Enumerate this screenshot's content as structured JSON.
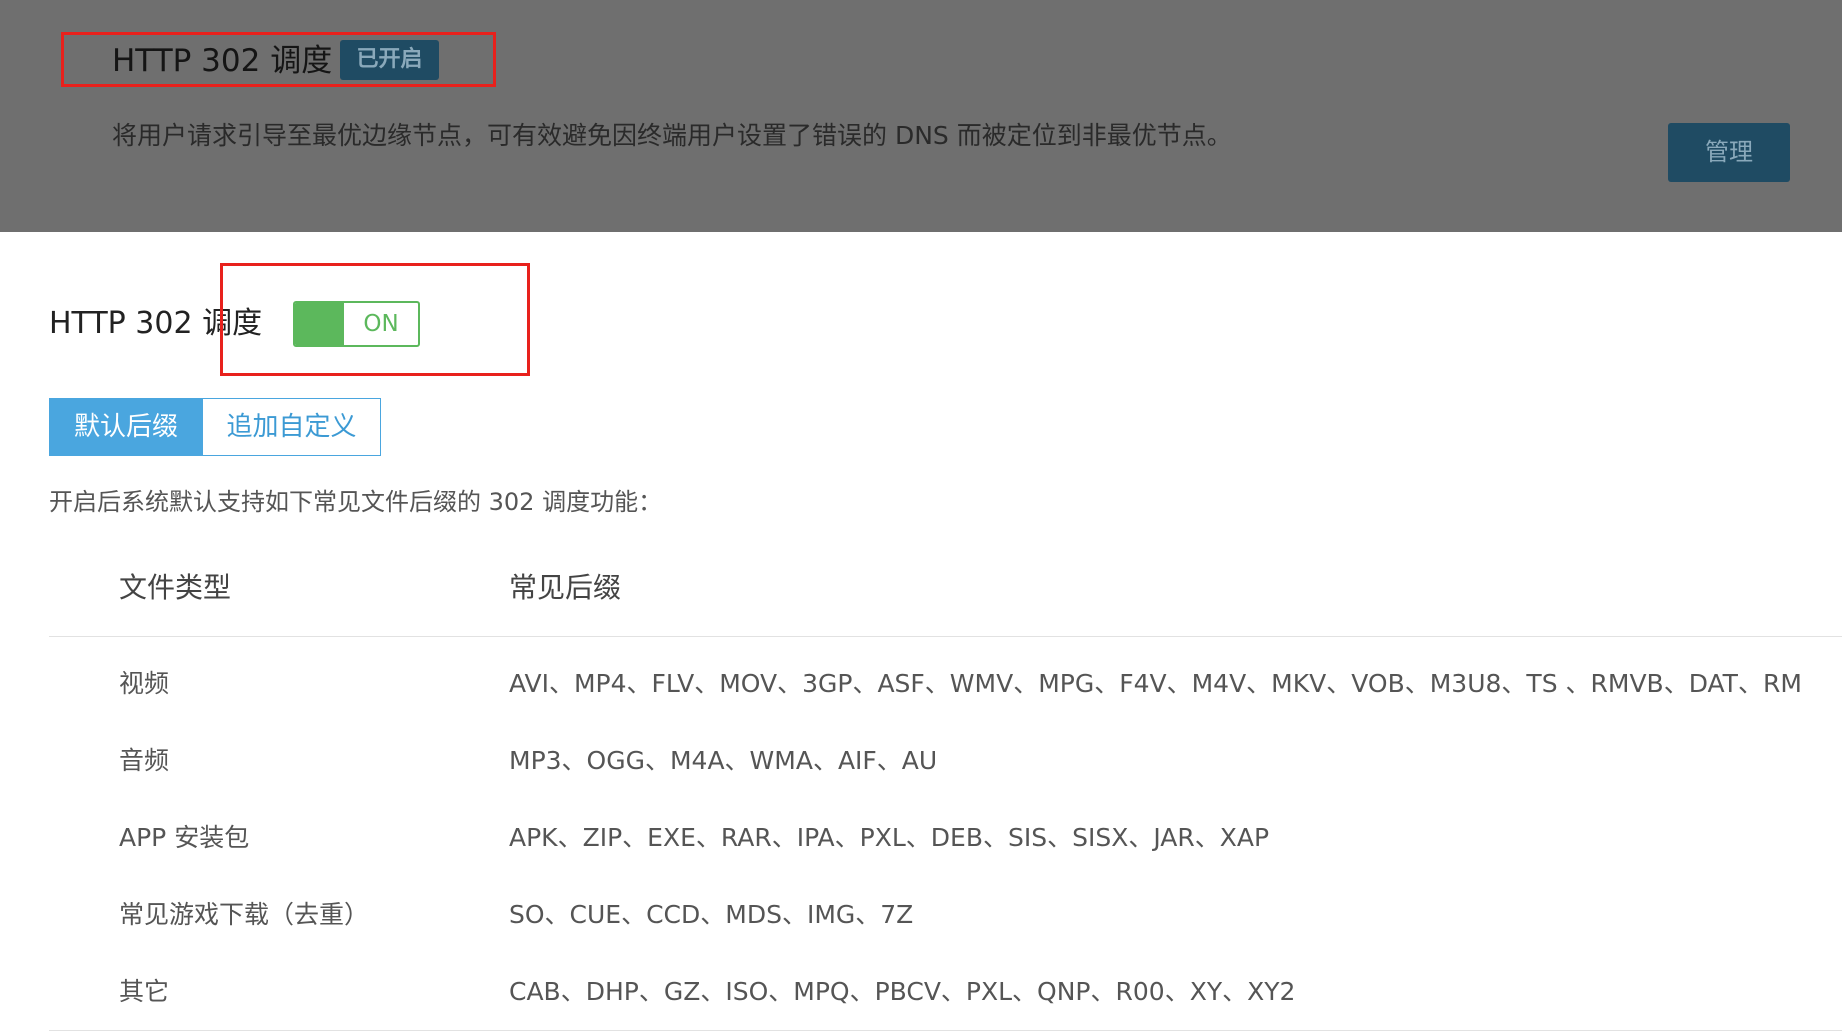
{
  "card": {
    "title": "HTTP 302 调度",
    "badge": "已开启",
    "description": "将用户请求引导至最优边缘节点，可有效避免因终端用户设置了错误的 DNS 而被定位到非最优节点。",
    "manage_label": "管理"
  },
  "setting": {
    "label": "HTTP 302 调度",
    "switch_label": "ON",
    "switch_on": true
  },
  "tabs": [
    {
      "label": "默认后缀",
      "active": true
    },
    {
      "label": "追加自定义",
      "active": false
    }
  ],
  "intro": "开启后系统默认支持如下常见文件后缀的 302 调度功能：",
  "table": {
    "headers": [
      "文件类型",
      "常见后缀"
    ],
    "rows": [
      {
        "type": "视频",
        "ext": "AVI、MP4、FLV、MOV、3GP、ASF、WMV、MPG、F4V、M4V、MKV、VOB、M3U8、TS 、RMVB、DAT、RM"
      },
      {
        "type": "音频",
        "ext": "MP3、OGG、M4A、WMA、AIF、AU"
      },
      {
        "type": "APP 安装包",
        "ext": "APK、ZIP、EXE、RAR、IPA、PXL、DEB、SIS、SISX、JAR、XAP"
      },
      {
        "type": "常见游戏下载（去重）",
        "ext": "SO、CUE、CCD、MDS、IMG、7Z"
      },
      {
        "type": "其它",
        "ext": "CAB、DHP、GZ、ISO、MPQ、PBCV、PXL、QNP、R00、XY、XY2"
      }
    ]
  },
  "colors": {
    "accent": "#4aa6df",
    "switch_on": "#5cb85c",
    "highlight": "#e8211c"
  }
}
